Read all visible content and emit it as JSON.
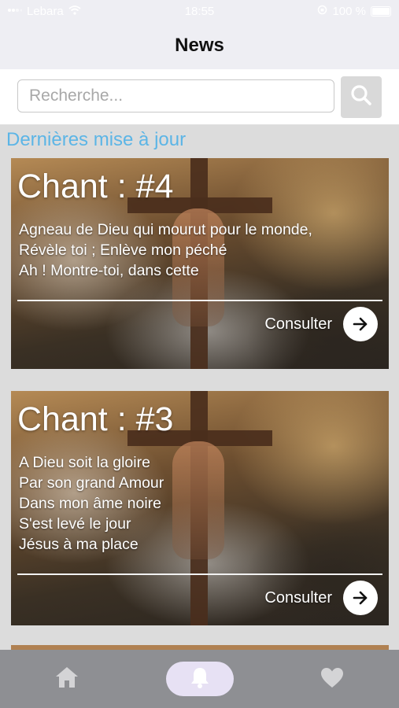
{
  "status_bar": {
    "carrier": "Lebara",
    "time": "18:55",
    "battery": "100 %"
  },
  "header": {
    "title": "News"
  },
  "search": {
    "placeholder": "Recherche...",
    "value": ""
  },
  "section": {
    "title": "Dernières mise à jour"
  },
  "cards": [
    {
      "title": "Chant : #4",
      "lines": [
        "Agneau de Dieu qui mourut pour le monde,",
        "Révèle toi ; Enlève mon péché",
        "Ah ! Montre-toi, dans cette"
      ],
      "action": "Consulter"
    },
    {
      "title": "Chant : #3",
      "lines": [
        "A Dieu soit la gloire",
        "Par son grand Amour",
        "Dans mon âme noire",
        "S'est levé le jour",
        "Jésus à ma place"
      ],
      "action": "Consulter"
    }
  ],
  "tab_bar": {
    "tabs": [
      {
        "name": "home",
        "icon": "home-icon"
      },
      {
        "name": "news",
        "icon": "bell-icon",
        "active": true
      },
      {
        "name": "favorites",
        "icon": "heart-icon"
      }
    ]
  },
  "colors": {
    "accent": "#5cb5e6",
    "active_tab": "#e7e1f4",
    "tab_bar": "#8e8f93"
  }
}
